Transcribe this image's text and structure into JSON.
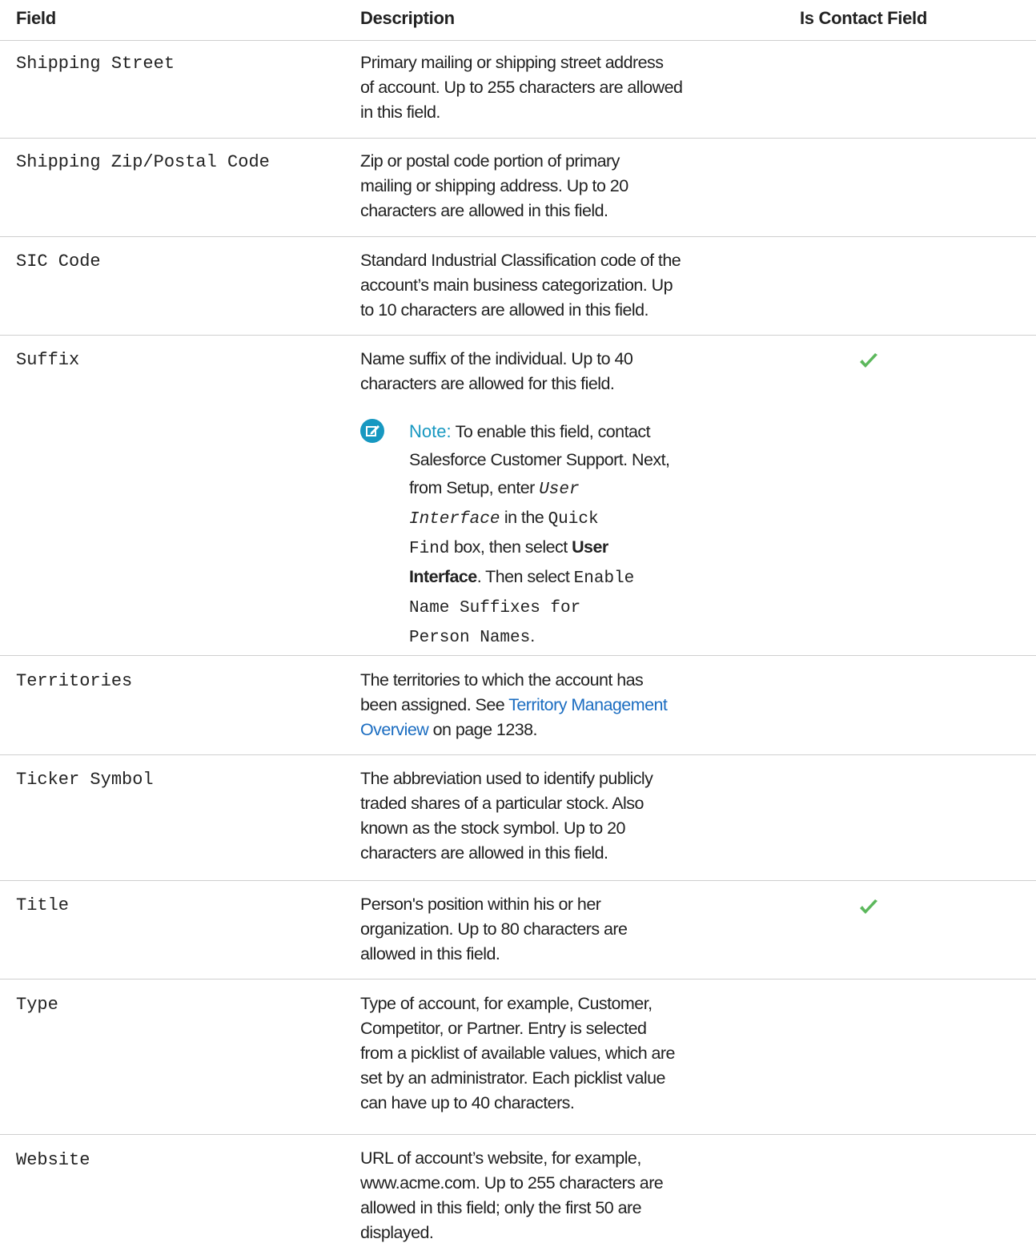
{
  "table": {
    "headers": [
      "Field",
      "Description",
      "Is Contact Field"
    ],
    "rows": [
      {
        "field": "Shipping Street",
        "desc": [
          "Primary mailing or shipping street address",
          "of account. Up to 255 characters are allowed",
          "in this field."
        ],
        "contact": false
      },
      {
        "field": "Shipping Zip/Postal Code",
        "desc": [
          "Zip or postal code portion of primary",
          "mailing or shipping address. Up to 20",
          "characters are allowed in this field."
        ],
        "contact": false
      },
      {
        "field": "SIC Code",
        "desc": [
          "Standard Industrial Classification code of the",
          "account’s main business categorization. Up",
          "to 10 characters are allowed in this field."
        ],
        "contact": false
      },
      {
        "field": "Suffix",
        "desc": [
          "Name suffix of the individual. Up to 40",
          "characters are allowed for this field."
        ],
        "contact": true
      },
      {
        "field": "Territories",
        "desc_pre": "The territories to which the account has",
        "desc_line2_pre": "been assigned. See ",
        "link_part1": "Territory Management",
        "link_part2": "Overview",
        "desc_line3_post": " on page 1238.",
        "contact": false
      },
      {
        "field": "Ticker Symbol",
        "desc": [
          "The abbreviation used to identify publicly",
          "traded shares of a particular stock. Also",
          "known as the stock symbol. Up to 20",
          "characters are allowed in this field."
        ],
        "contact": false
      },
      {
        "field": "Title",
        "desc": [
          "Person's position within his or her",
          "organization. Up to 80 characters are",
          "allowed in this field."
        ],
        "contact": true
      },
      {
        "field": "Type",
        "desc": [
          "Type of account, for example, Customer,",
          "Competitor, or Partner. Entry is selected",
          "from a picklist of available values, which are",
          "set by an administrator. Each picklist value",
          "can have up to 40 characters."
        ],
        "contact": false
      },
      {
        "field": "Website",
        "desc": [
          "URL of account’s website, for example,",
          "www.acme.com. Up to 255 characters are",
          "allowed in this field; only the first 50 are",
          "displayed."
        ],
        "contact": false
      }
    ]
  },
  "note": {
    "title": "Note:",
    "l1": " To enable this field, contact",
    "l2": "Salesforce Customer Support. Next,",
    "l3_pre": "from Setup, enter ",
    "l3_code": "User",
    "l4_code": "Interface",
    "l4_mid": " in the ",
    "l4_code2": "Quick",
    "l5_code": "Find",
    "l5_mid": " box, then select ",
    "l5_bold": "User",
    "l6_bold": "Interface",
    "l6_mid": ". Then select ",
    "l6_code": "Enable",
    "l7_code": "Name Suffixes for",
    "l8_code": "Person Names",
    "l8_end": "."
  },
  "colors": {
    "accent": "#1798c1",
    "link": "#1b6dc1",
    "check": "#5cb85c",
    "rule": "#cfcfcf"
  },
  "icons": {
    "contact_mark": "checkmark-icon",
    "note_mark": "edit-note-icon"
  }
}
